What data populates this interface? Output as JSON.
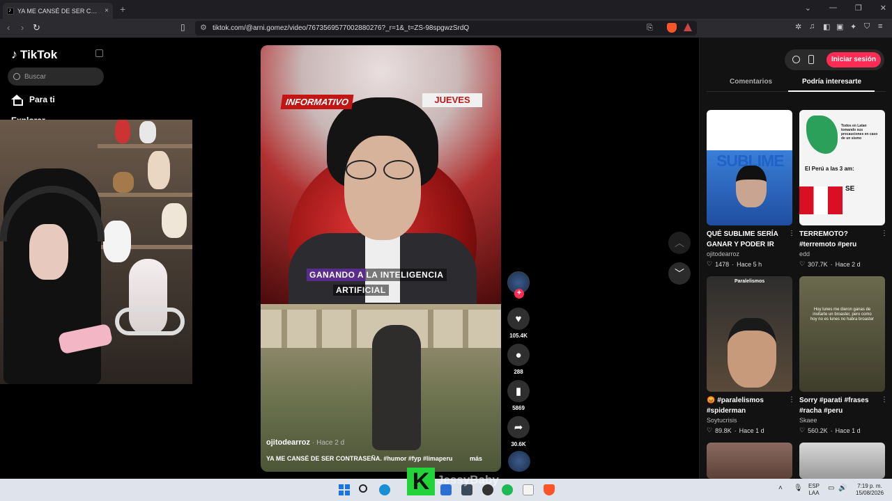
{
  "browser": {
    "tab_title": "YA ME CANSÉ DE SER CONTRASEÑA",
    "tab_close": "×",
    "new_tab": "+",
    "url": "tiktok.com/@arni.gomez/video/7673569577002880276?_r=1&_t=ZS-98spgwzSrdQ",
    "window_controls": [
      "⌄",
      "—",
      "❐",
      "✕"
    ]
  },
  "sidebar": {
    "logo": "TikTok",
    "search_placeholder": "Buscar",
    "for_you": "Para ti",
    "explore": "Explorar"
  },
  "video": {
    "badge_left": "INFORMATIVO",
    "badge_right": "JUEVES",
    "caption_line1": "GANANDO A LA INTELIGENCIA",
    "caption_line2": "ARTIFICIAL",
    "author": "ojitodearroz",
    "posted": "· Hace 2 d",
    "description": "YA ME CANSÉ DE SER CONTRASEÑA.  #humor #fyp #limaperu",
    "more": "más"
  },
  "actions": {
    "follow": "+",
    "likes": "105.4K",
    "comments": "288",
    "saves": "5869",
    "shares": "30.6K"
  },
  "right_panel": {
    "login": "Iniciar sesión",
    "tab_comments": "Comentarios",
    "tab_interest": "Podría interesarte",
    "cards": [
      {
        "title": "QUÉ SUBLIME SERÍA GANAR Y PODER IR A...",
        "author": "ojitodearroz",
        "likes": "1478",
        "when": "Hace 5 h",
        "thumb_text": "SUBLIME"
      },
      {
        "title": "TERREMOTO? #terremoto #peru",
        "author": "edd",
        "likes": "307.7K",
        "when": "Hace 2 d",
        "thumb_text": "Todos en Latan tomando sus precauciones en caso de un sismo",
        "thumb_text2": "El Perú a las 3 am:",
        "thumb_text3": "SE"
      },
      {
        "title": "😡 #paralelismos #spiderman",
        "author": "Soytucrisis",
        "likes": "89.8K",
        "when": "Hace 1 d",
        "thumb_text": "Paralelismos"
      },
      {
        "title": "Sorry #parati #frases #racha #peru",
        "author": "Skaee",
        "likes": "560.2K",
        "when": "Hace 1 d",
        "thumb_text": "Hoy lunes me dieron ganas de invitarte un broaster, pero como hoy no es lunes no habra broaster"
      }
    ]
  },
  "overlay": {
    "streamer_badge": "K",
    "streamer_name": "JessyBaby"
  },
  "taskbar": {
    "lang_top": "ESP",
    "lang_bottom": "LAA",
    "time": "7:19 p. m.",
    "date": "15/08/2026"
  },
  "colors": {
    "accent": "#fe2c55",
    "badge_green": "#22d33a"
  }
}
